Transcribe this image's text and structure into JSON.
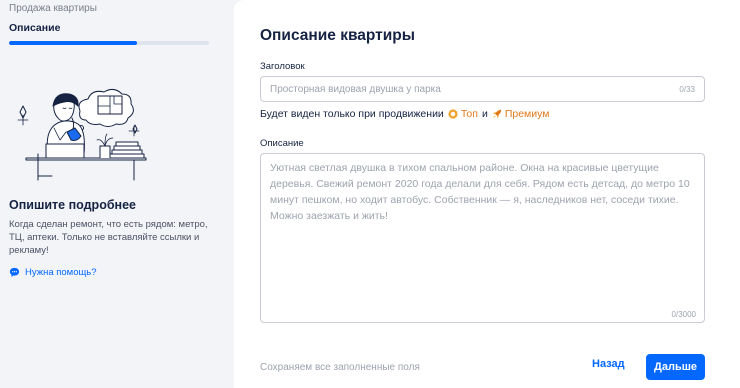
{
  "sidebar": {
    "breadcrumb": "Продажа квартиры",
    "step_title": "Описание",
    "progress": 0.64,
    "heading": "Опишите подробнее",
    "text": "Когда сделан ремонт, что есть рядом: метро, ТЦ, аптеки. Только не вставляйте ссылки и рекламу!",
    "help_label": "Нужна помощь?",
    "help_icon": "chat-bubble-icon",
    "illustration_icon": "person-at-desk-illustration"
  },
  "form": {
    "title": "Описание квартиры",
    "title_field": {
      "label": "Заголовок",
      "placeholder": "Просторная видовая двушка у парка",
      "counter": "0/33"
    },
    "promo": {
      "text": "Будет виден только при продвижении",
      "top_label": "Топ",
      "top_icon": "sun-badge-icon",
      "and": "и",
      "premium_label": "Премиум",
      "premium_icon": "rocket-icon"
    },
    "description_field": {
      "label": "Описание",
      "placeholder": "Уютная светлая двушка в тихом спальном районе. Окна на красивые цветущие деревья. Свежий ремонт 2020 года делали для себя. Рядом есть детсад, до метро 10 минут пешком, но ходит автобус. Собственник — я, наследников нет, соседи тихие. Можно заезжать и жить!",
      "counter": "0/3000"
    },
    "save_note": "Сохраняем все заполненные поля",
    "back_label": "Назад",
    "next_label": "Дальше"
  },
  "colors": {
    "accent": "#0468ff",
    "promo": "#e0791a",
    "background": "#f3f4f8"
  }
}
